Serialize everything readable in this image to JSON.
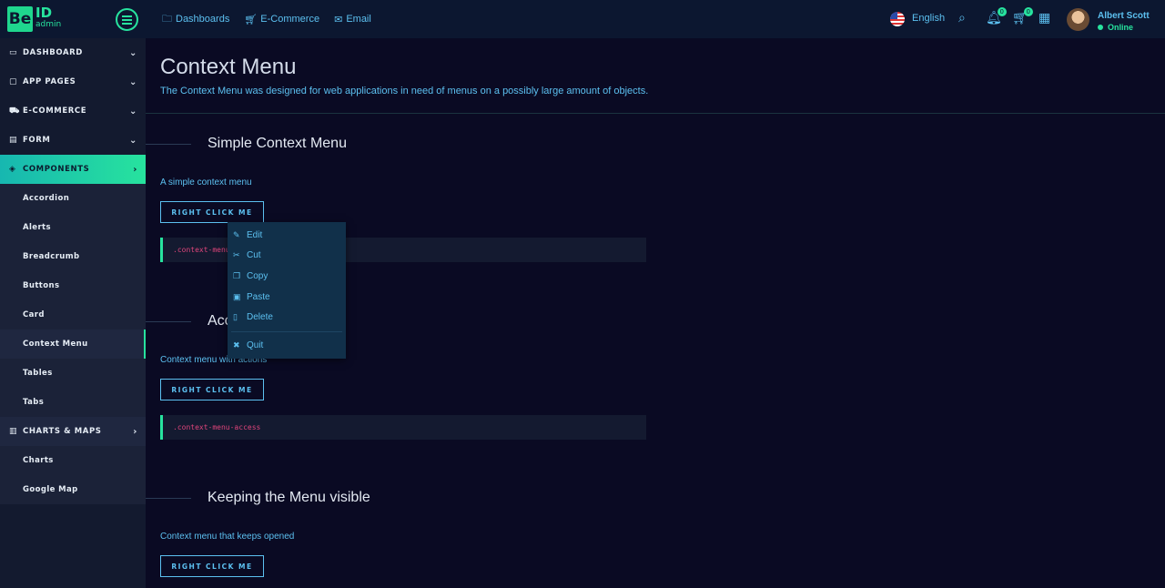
{
  "logo": {
    "mark": "Be",
    "name": "ID",
    "sub": "admin"
  },
  "topnav": [
    {
      "label": "Dashboards",
      "icon": "folder-icon"
    },
    {
      "label": "E-Commerce",
      "icon": "cart-icon"
    },
    {
      "label": "Email",
      "icon": "mail-icon"
    }
  ],
  "header": {
    "language": "English",
    "notification_count": "0",
    "cart_count": "0",
    "user_name": "Albert Scott",
    "user_status": "Online"
  },
  "sidebar": {
    "items": [
      {
        "label": "DASHBOARD"
      },
      {
        "label": "APP PAGES"
      },
      {
        "label": "E-COMMERCE"
      },
      {
        "label": "FORM"
      },
      {
        "label": "COMPONENTS"
      }
    ],
    "components_sub": [
      "Accordion",
      "Alerts",
      "Breadcrumb",
      "Buttons",
      "Card",
      "Context Menu",
      "Tables",
      "Tabs"
    ],
    "charts": {
      "label": "CHARTS & MAPS",
      "sub": [
        "Charts",
        "Google Map"
      ]
    }
  },
  "main": {
    "title": "Context Menu",
    "subtitle": "The Context Menu was designed for web applications in need of menus on a possibly large amount of objects.",
    "sections": [
      {
        "title": "Simple Context Menu",
        "desc": "A simple context menu",
        "button": "RIGHT CLICK ME",
        "code": ".context-menu-one"
      },
      {
        "title": "Access Keys",
        "desc": "Context menu with actions",
        "button": "RIGHT CLICK ME",
        "code": ".context-menu-access"
      },
      {
        "title": "Keeping the Menu visible",
        "desc": "Context menu that keeps opened",
        "button": "RIGHT CLICK ME"
      }
    ]
  },
  "context_menu": {
    "items": [
      "Edit",
      "Cut",
      "Copy",
      "Paste",
      "Delete"
    ],
    "quit": "Quit"
  },
  "colors": {
    "accent": "#27e39e",
    "link": "#5cc0f0",
    "background": "#0a0a23",
    "code": "#e0457b"
  }
}
